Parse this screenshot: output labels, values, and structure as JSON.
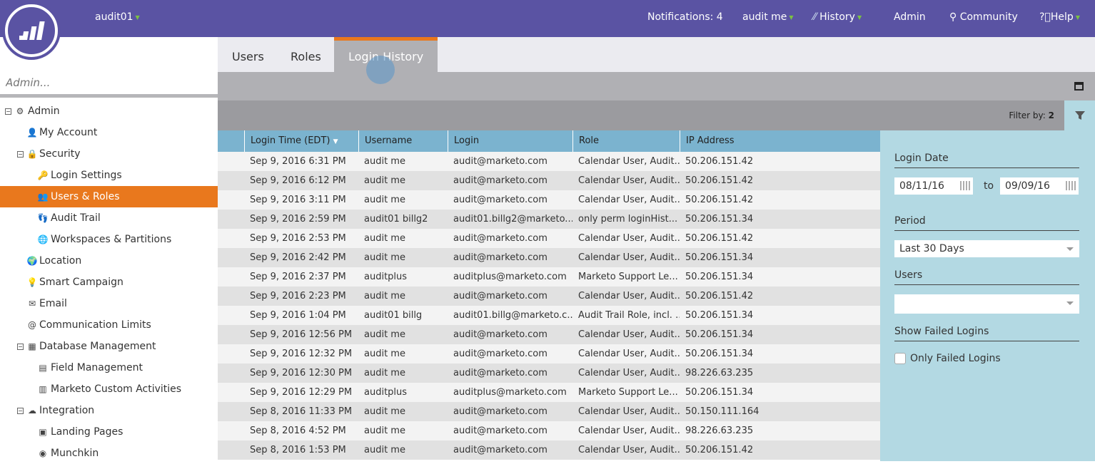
{
  "topbar": {
    "workspace": "audit01",
    "notifications": "Notifications: 4",
    "user": "audit me",
    "history": "History",
    "admin": "Admin",
    "community": "Community",
    "help": "Help"
  },
  "sidebar": {
    "search_placeholder": "Admin...",
    "items": [
      {
        "label": "Admin",
        "level": 0,
        "icon": "gear-icon",
        "glyph": "⚙",
        "expander": "−"
      },
      {
        "label": "My Account",
        "level": 1,
        "icon": "user-icon",
        "glyph": "👤"
      },
      {
        "label": "Security",
        "level": 1,
        "icon": "lock-icon",
        "glyph": "🔒",
        "expander": "−"
      },
      {
        "label": "Login Settings",
        "level": 2,
        "icon": "key-icon",
        "glyph": "🔑"
      },
      {
        "label": "Users & Roles",
        "level": 2,
        "icon": "users-icon",
        "glyph": "👥",
        "selected": true
      },
      {
        "label": "Audit Trail",
        "level": 2,
        "icon": "footprints-icon",
        "glyph": "👣"
      },
      {
        "label": "Workspaces & Partitions",
        "level": 2,
        "icon": "globe-icon",
        "glyph": "🌐"
      },
      {
        "label": "Location",
        "level": 1,
        "icon": "globe-pin-icon",
        "glyph": "🌍"
      },
      {
        "label": "Smart Campaign",
        "level": 1,
        "icon": "lightbulb-icon",
        "glyph": "💡"
      },
      {
        "label": "Email",
        "level": 1,
        "icon": "email-icon",
        "glyph": "✉"
      },
      {
        "label": "Communication Limits",
        "level": 1,
        "icon": "at-icon",
        "glyph": "@"
      },
      {
        "label": "Database Management",
        "level": 1,
        "icon": "database-icon",
        "glyph": "▦",
        "expander": "−"
      },
      {
        "label": "Field Management",
        "level": 2,
        "icon": "field-icon",
        "glyph": "▤"
      },
      {
        "label": "Marketo Custom Activities",
        "level": 2,
        "icon": "activities-icon",
        "glyph": "▥"
      },
      {
        "label": "Integration",
        "level": 1,
        "icon": "cloud-icon",
        "glyph": "☁",
        "expander": "−"
      },
      {
        "label": "Landing Pages",
        "level": 2,
        "icon": "landing-page-icon",
        "glyph": "▣"
      },
      {
        "label": "Munchkin",
        "level": 2,
        "icon": "munchkin-icon",
        "glyph": "◉"
      }
    ]
  },
  "tabs": [
    {
      "label": "Users"
    },
    {
      "label": "Roles"
    },
    {
      "label": "Login History",
      "active": true
    }
  ],
  "filter": {
    "label": "Filter by: ",
    "count": "2"
  },
  "table": {
    "headers": [
      "",
      "Login Time (EDT)",
      "Username",
      "Login",
      "Role",
      "IP Address"
    ],
    "rows": [
      [
        "Sep 9, 2016 6:31 PM",
        "audit me",
        "audit@marketo.com",
        "Calendar User, Audit...",
        "50.206.151.42"
      ],
      [
        "Sep 9, 2016 6:12 PM",
        "audit me",
        "audit@marketo.com",
        "Calendar User, Audit...",
        "50.206.151.42"
      ],
      [
        "Sep 9, 2016 3:11 PM",
        "audit me",
        "audit@marketo.com",
        "Calendar User, Audit...",
        "50.206.151.42"
      ],
      [
        "Sep 9, 2016 2:59 PM",
        "audit01 billg2",
        "audit01.billg2@marketo....",
        "only perm loginHist...",
        "50.206.151.34"
      ],
      [
        "Sep 9, 2016 2:53 PM",
        "audit me",
        "audit@marketo.com",
        "Calendar User, Audit...",
        "50.206.151.42"
      ],
      [
        "Sep 9, 2016 2:42 PM",
        "audit me",
        "audit@marketo.com",
        "Calendar User, Audit...",
        "50.206.151.34"
      ],
      [
        "Sep 9, 2016 2:37 PM",
        "auditplus",
        "auditplus@marketo.com",
        "Marketo Support Le...",
        "50.206.151.34"
      ],
      [
        "Sep 9, 2016 2:23 PM",
        "audit me",
        "audit@marketo.com",
        "Calendar User, Audit...",
        "50.206.151.42"
      ],
      [
        "Sep 9, 2016 1:04 PM",
        "audit01 billg",
        "audit01.billg@marketo.c...",
        "Audit Trail Role, incl. ...",
        "50.206.151.34"
      ],
      [
        "Sep 9, 2016 12:56 PM",
        "audit me",
        "audit@marketo.com",
        "Calendar User, Audit...",
        "50.206.151.34"
      ],
      [
        "Sep 9, 2016 12:32 PM",
        "audit me",
        "audit@marketo.com",
        "Calendar User, Audit...",
        "50.206.151.34"
      ],
      [
        "Sep 9, 2016 12:30 PM",
        "audit me",
        "audit@marketo.com",
        "Calendar User, Audit...",
        "98.226.63.235"
      ],
      [
        "Sep 9, 2016 12:29 PM",
        "auditplus",
        "auditplus@marketo.com",
        "Marketo Support Le...",
        "50.206.151.34"
      ],
      [
        "Sep 8, 2016 11:33 PM",
        "audit me",
        "audit@marketo.com",
        "Calendar User, Audit...",
        "50.150.111.164"
      ],
      [
        "Sep 8, 2016 4:52 PM",
        "audit me",
        "audit@marketo.com",
        "Calendar User, Audit...",
        "98.226.63.235"
      ],
      [
        "Sep 8, 2016 1:53 PM",
        "audit me",
        "audit@marketo.com",
        "Calendar User, Audit...",
        "50.206.151.42"
      ]
    ]
  },
  "panel": {
    "login_date": "Login Date",
    "from": "08/11/16",
    "to_label": "to",
    "to": "09/09/16",
    "period": "Period",
    "period_value": "Last 30 Days",
    "users": "Users",
    "users_value": "",
    "show_failed": "Show Failed Logins",
    "only_failed": "Only Failed Logins"
  }
}
